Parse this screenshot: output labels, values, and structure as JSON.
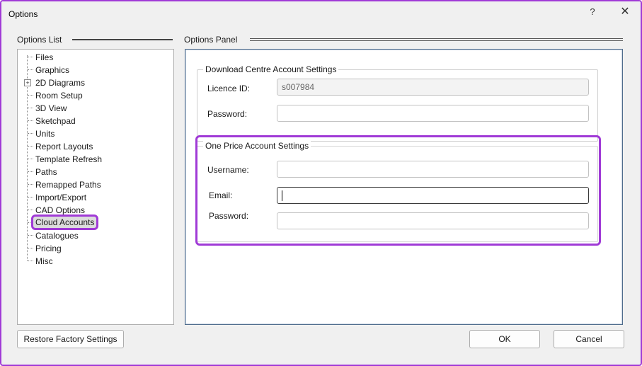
{
  "window": {
    "title": "Options",
    "help_glyph": "?",
    "close_glyph": "✕"
  },
  "left": {
    "section_label": "Options List",
    "tree_items": [
      {
        "label": "Files",
        "expandable": false,
        "selected": false
      },
      {
        "label": "Graphics",
        "expandable": false,
        "selected": false
      },
      {
        "label": "2D Diagrams",
        "expandable": true,
        "selected": false
      },
      {
        "label": "Room Setup",
        "expandable": false,
        "selected": false
      },
      {
        "label": "3D View",
        "expandable": false,
        "selected": false
      },
      {
        "label": "Sketchpad",
        "expandable": false,
        "selected": false
      },
      {
        "label": "Units",
        "expandable": false,
        "selected": false
      },
      {
        "label": "Report Layouts",
        "expandable": false,
        "selected": false
      },
      {
        "label": "Template Refresh",
        "expandable": false,
        "selected": false
      },
      {
        "label": "Paths",
        "expandable": false,
        "selected": false
      },
      {
        "label": "Remapped Paths",
        "expandable": false,
        "selected": false
      },
      {
        "label": "Import/Export",
        "expandable": false,
        "selected": false
      },
      {
        "label": "CAD Options",
        "expandable": false,
        "selected": false
      },
      {
        "label": "Cloud Accounts",
        "expandable": false,
        "selected": true
      },
      {
        "label": "Catalogues",
        "expandable": false,
        "selected": false
      },
      {
        "label": "Pricing",
        "expandable": false,
        "selected": false
      },
      {
        "label": "Misc",
        "expandable": false,
        "selected": false
      }
    ],
    "expander_glyph": "+"
  },
  "right": {
    "section_label": "Options Panel",
    "download_centre": {
      "title": "Download Centre Account Settings",
      "licence_label": "Licence ID:",
      "licence_value": "s007984",
      "password_label": "Password:",
      "password_value": ""
    },
    "one_price": {
      "title": "One Price Account Settings",
      "username_label": "Username:",
      "username_value": "",
      "email_label": "Email:",
      "email_value": "",
      "password_label": "Password:",
      "password_value": ""
    }
  },
  "footer": {
    "restore_label": "Restore Factory Settings",
    "ok_label": "OK",
    "cancel_label": "Cancel"
  },
  "colors": {
    "highlight": "#a03ad6",
    "panel_border": "#4f6c8c"
  }
}
